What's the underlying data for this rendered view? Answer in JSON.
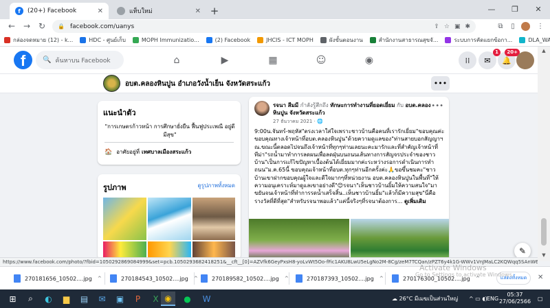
{
  "browser": {
    "tabs": [
      {
        "title": "(20+) Facebook",
        "favicon": "facebook-favicon"
      },
      {
        "title": "แท็บใหม่",
        "favicon": "newtab-favicon"
      }
    ],
    "url": "facebook.com/uanys",
    "bookmarks": [
      {
        "label": "กล่องจดหมาย (12) - k...",
        "color": "#d93025"
      },
      {
        "label": "HDC - ศูนย์เก็บ",
        "color": "#1a73e8"
      },
      {
        "label": "MOPH Immunizatio...",
        "color": "#34a853"
      },
      {
        "label": "(2) Facebook",
        "color": "#1877f2"
      },
      {
        "label": "JHCIS - ICT MOPH",
        "color": "#f29900"
      },
      {
        "label": "ผังขั้นตอนงาน",
        "color": "#5f6368"
      },
      {
        "label": "สำนักงานสาธารณสุขจั...",
        "color": "#188038"
      },
      {
        "label": "ระบบการคัดแยกข้อกา...",
        "color": "#9334e6"
      },
      {
        "label": "DLA_WASTE : INFO...",
        "color": "#12b5cb"
      }
    ]
  },
  "fb": {
    "search_placeholder": "ค้นหาบน Facebook",
    "messenger_badge": "1",
    "notif_badge": "20+"
  },
  "page": {
    "name": "อบต.คลองหินปูน อำเภอวังน้ำเย็น จังหวัดสระแก้ว"
  },
  "intro": {
    "title": "แนะนำตัว",
    "bio": "\"การเกษตรก้าวหน้า การศึกษายั่งยืน ฟื้นฟูประเพณี อยู่ดีมีสุข\"",
    "location_prefix": "อาศัยอยู่ที่",
    "location": "เทศบาลเมืองสระแก้ว"
  },
  "photos": {
    "title": "รูปภาพ",
    "see_all": "ดูรูปภาพทั้งหมด"
  },
  "post": {
    "author": "รจนา สีมมี",
    "feeling": "กำลังรู้สึกถึง",
    "activity": "ทักษะการทำงานที่ยอดเยี่ยม",
    "with": "กับ",
    "with_page": "อบต.คลองหินปูน จังหวัดสระแก้ว",
    "date": "27 ธันวาคม 2021 · 🌐",
    "text": "9:00น.จันทร์-พฤหัส\"ตรงเวลาใส่ใจเพราะชาวบ้านคือคนที่เรารักเยี่ยม\"ขอบคุณค่ะขอบคุณทางเจ้าหน้าที่อบต.คลองหินปูน\"ด้วยความดูแลของ\"ท่านสายบอกสัญญาฯ ณ.ขณะนี้ตลอดไปจนถึงเจ้าหน้าที่ทุกๆท่านเลยนะคะมารักและที่สำคัญเจ้าหน้าที่ ทีม่า\"รถน้ำมาทำการลดผนเพื่อลดฝุ่นบนถนนเส้นทางการสัญจรประจำของชาวบ้าน\"เป็นการแก้ไขปัญหาเบื้องต้นได้เยี่ยมมากค่ะระหว่างรอการดำเนินการทำถนน\"ม.ค.65นี้ ขอบคุณเจ้าหน้าที่อบต.ทุกๆท่านอีกครั้งค่ะ🙏ขอขึ้นชมคะ\"ชาวบ้านเขาฝากขอบคุณผู้ใจและดีใจมากๆที่หน่วยงาน อบต.คลองหินปูนในพื้นที่\"ให้ความอนุเคราะห์มาดูแลเขาอย่างดี\"😊รจนา\"เห็นชาวบ้านยิ้มให้ความสนใจ\"มาขยันจนเจ้าหน้าที่ทำการรดน้ำเสร็จสิ้น..เห็นชาวบ้านยิ้ม\"แล้วก็มีความสุข\"นี่คือรางวัลที่ดีที่สุด\"สำหรับรจนาพอแล้ว\"แค่นี้จริงๆที่รจนาต้องการ...",
    "more": "ดูเพิ่มเติม"
  },
  "status_url": "https://www.facebook.com/photo/?fbid=1050292869084999&set=pcb.1050293682418251&__cft__[0]=AZVfk6GeyPxsH8-yoLvWt5Oo-fFic1AKU8LwU5eLgNo2M-8Cg/zeM7TCQan/zPZT6y4k1G-WWv1VnJMaLC2KQWqq5SAnW65ZMUCWeW7WiX2...",
  "downloads": [
    {
      "name": "270181656_10502....jpg"
    },
    {
      "name": "270184543_10502....jpg"
    },
    {
      "name": "270189582_10502....jpg"
    },
    {
      "name": "270187393_10502....jpg"
    },
    {
      "name": "270176300_10502....jpg"
    }
  ],
  "downloads_show_all": "แสดงทั้งหมด",
  "windows_watermark": {
    "title": "Activate Windows",
    "subtitle": "Go to Settings to activate Windows."
  },
  "taskbar": {
    "weather": "26°C มีเมฆเป็นส่วนใหญ่",
    "lang": "ENG",
    "time": "05:37",
    "date": "27/06/2566"
  }
}
